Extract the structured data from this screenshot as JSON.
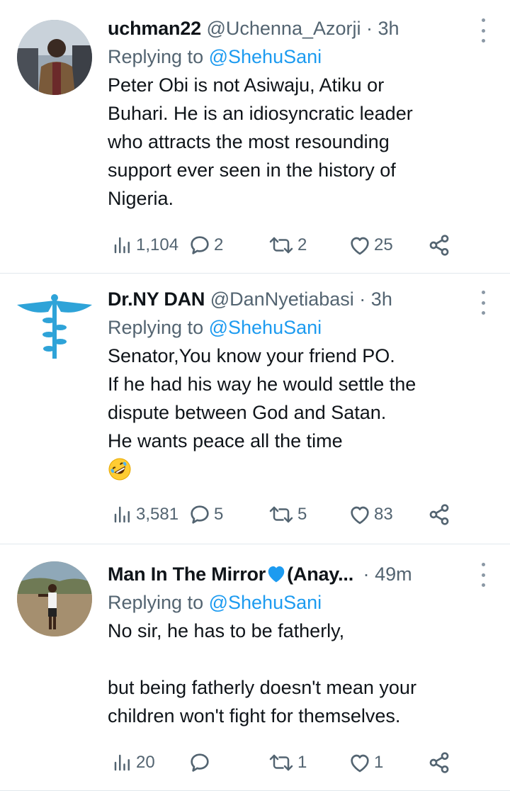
{
  "tweets": [
    {
      "name": "uchman22",
      "handle": "@Uchenna_Azorji",
      "separator": "·",
      "time": "3h",
      "replying_prefix": "Replying to",
      "replying_to": "@ShehuSani",
      "body": "Peter Obi is not Asiwaju, Atiku or\nBuhari. He is an idiosyncratic leader\nwho attracts the most resounding\nsupport ever seen in the history of\nNigeria.",
      "views": "1,104",
      "replies": "2",
      "retweets": "2",
      "likes": "25"
    },
    {
      "name": "Dr.NY DAN",
      "handle": "@DanNyetiabasi",
      "separator": "·",
      "time": "3h",
      "replying_prefix": "Replying to",
      "replying_to": "@ShehuSani",
      "body": "Senator,You know your friend PO.\nIf he had his way he would settle the\ndispute between God and Satan.\nHe wants peace all the time",
      "emoji": "rolling-on-floor-laughing-emoji",
      "views": "3,581",
      "replies": "5",
      "retweets": "5",
      "likes": "83"
    },
    {
      "name": "Man In The Mirror",
      "name_suffix": "(Anay...",
      "heart_emoji": "blue-heart-emoji",
      "handle": "",
      "separator": "·",
      "time": "49m",
      "replying_prefix": "Replying to",
      "replying_to": "@ShehuSani",
      "body": "No sir, he has to be fatherly,\n\nbut being fatherly doesn't mean your\nchildren won't fight for themselves.",
      "views": "20",
      "replies": "",
      "retweets": "1",
      "likes": "1"
    }
  ],
  "colors": {
    "text": "#0f1419",
    "secondary": "#536471",
    "link": "#1d9bf0",
    "divider": "#e1e8ed",
    "blue_heart": "#1d9bf0"
  },
  "icons": [
    "views-icon",
    "reply-icon",
    "retweet-icon",
    "like-icon",
    "share-icon",
    "more-icon"
  ]
}
